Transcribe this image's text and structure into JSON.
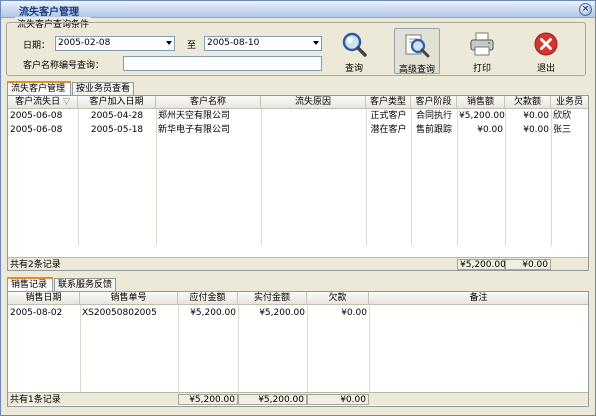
{
  "window": {
    "title": "流失客户管理",
    "close_glyph": "×"
  },
  "query": {
    "legend": "流失客户查询条件",
    "date_label": "日期：",
    "date_from": "2005-02-08",
    "to_label": "至",
    "date_to": "2005-08-10",
    "name_label": "客户名称编号查询：",
    "name_value": ""
  },
  "toolbar": {
    "query_label": "查询",
    "advanced_label": "高级查询",
    "print_label": "打印",
    "exit_label": "退出"
  },
  "top_tabs": [
    {
      "label": "流失客户管理",
      "active": true
    },
    {
      "label": "按业务员查看",
      "active": false
    }
  ],
  "customers": {
    "headers": [
      "客户流失日",
      "客户加入日期",
      "客户名称",
      "流失原因",
      "客户类型",
      "客户阶段",
      "销售额",
      "欠款额",
      "业务员"
    ],
    "rows": [
      [
        "2005-06-08",
        "2005-04-28",
        "郑州天空有限公司",
        "",
        "正式客户",
        "合同执行",
        "¥5,200.00",
        "¥0.00",
        "欣欣"
      ],
      [
        "2005-06-08",
        "2005-05-18",
        "新华电子有限公司",
        "",
        "潜在客户",
        "售前跟踪",
        "¥0.00",
        "¥0.00",
        "张三"
      ]
    ],
    "footer_count": "共有2条记录",
    "footer_sales": "¥5,200.00",
    "footer_debt": "¥0.00"
  },
  "bottom_tabs": [
    {
      "label": "销售记录",
      "active": true
    },
    {
      "label": "联系服务反馈",
      "active": false
    }
  ],
  "sales": {
    "headers": [
      "销售日期",
      "销售单号",
      "应付金额",
      "实付金额",
      "欠款",
      "备注"
    ],
    "rows": [
      [
        "2005-08-02",
        "XS20050802005",
        "¥5,200.00",
        "¥5,200.00",
        "¥0.00",
        ""
      ]
    ],
    "footer_count": "共有1条记录",
    "footer_payable": "¥5,200.00",
    "footer_paid": "¥5,200.00",
    "footer_debt": "¥0.00"
  },
  "colors": {
    "title_text": "#1b3c83",
    "tab_accent": "#e68b2c",
    "exit_red": "#d8332c"
  }
}
